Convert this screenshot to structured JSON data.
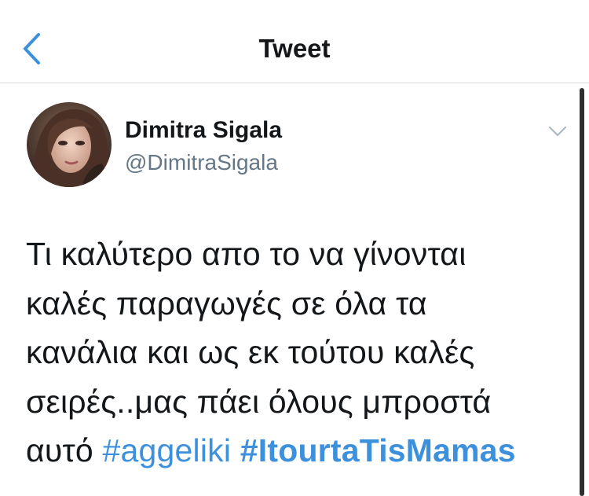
{
  "nav": {
    "title": "Tweet",
    "back_icon": "chevron-left-icon"
  },
  "tweet": {
    "author": {
      "name": "Dimitra Sigala",
      "handle": "@DimitraSigala",
      "avatar": "avatar-photo"
    },
    "more_icon": "chevron-down-icon",
    "text_lines": [
      "Τι καλύτερο απο το να γίνονται",
      "καλές παραγωγές σε όλα τα",
      "κανάλια και ως εκ τούτου καλές",
      "σειρές..μας πάει όλους μπροστά",
      "αυτό "
    ],
    "hashtags": [
      "#aggeliki",
      "#ItourtaTisMamas"
    ]
  },
  "colors": {
    "accent": "#3d90dc",
    "text": "#14171a",
    "secondary_text": "#657786",
    "divider": "#d6d9dc"
  }
}
